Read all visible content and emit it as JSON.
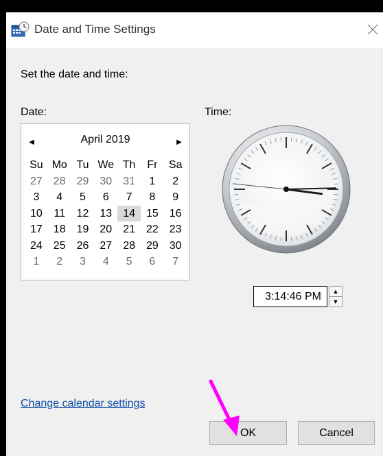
{
  "window": {
    "title": "Date and Time Settings",
    "icon": "calendar-clock-icon"
  },
  "main": {
    "instruction": "Set the date and time:",
    "date_label": "Date:",
    "time_label": "Time:"
  },
  "calendar": {
    "month": "April",
    "year": "2019",
    "prev_icon": "triangle-left-icon",
    "next_icon": "triangle-right-icon",
    "prev_glyph": "◀",
    "next_glyph": "▶",
    "days_of_week": [
      "Su",
      "Mo",
      "Tu",
      "We",
      "Th",
      "Fr",
      "Sa"
    ],
    "weeks": [
      [
        "27",
        "28",
        "29",
        "30",
        "31",
        "1",
        "2"
      ],
      [
        "3",
        "4",
        "5",
        "6",
        "7",
        "8",
        "9"
      ],
      [
        "10",
        "11",
        "12",
        "13",
        "14",
        "15",
        "16"
      ],
      [
        "17",
        "18",
        "19",
        "20",
        "21",
        "22",
        "23"
      ],
      [
        "24",
        "25",
        "26",
        "27",
        "28",
        "29",
        "30"
      ],
      [
        "1",
        "2",
        "3",
        "4",
        "5",
        "6",
        "7"
      ]
    ],
    "selected_day": "14"
  },
  "clock": {
    "hour": 3,
    "minute": 14,
    "second": 46
  },
  "time": {
    "value": "3:14:46 PM",
    "up_glyph": "▲",
    "down_glyph": "▼"
  },
  "links": {
    "change_calendar": "Change calendar settings"
  },
  "buttons": {
    "ok": "OK",
    "cancel": "Cancel"
  },
  "colors": {
    "link": "#0f4fa8",
    "annotation_arrow": "#ff00ff",
    "selected_day_bg": "#d9d9d9"
  }
}
